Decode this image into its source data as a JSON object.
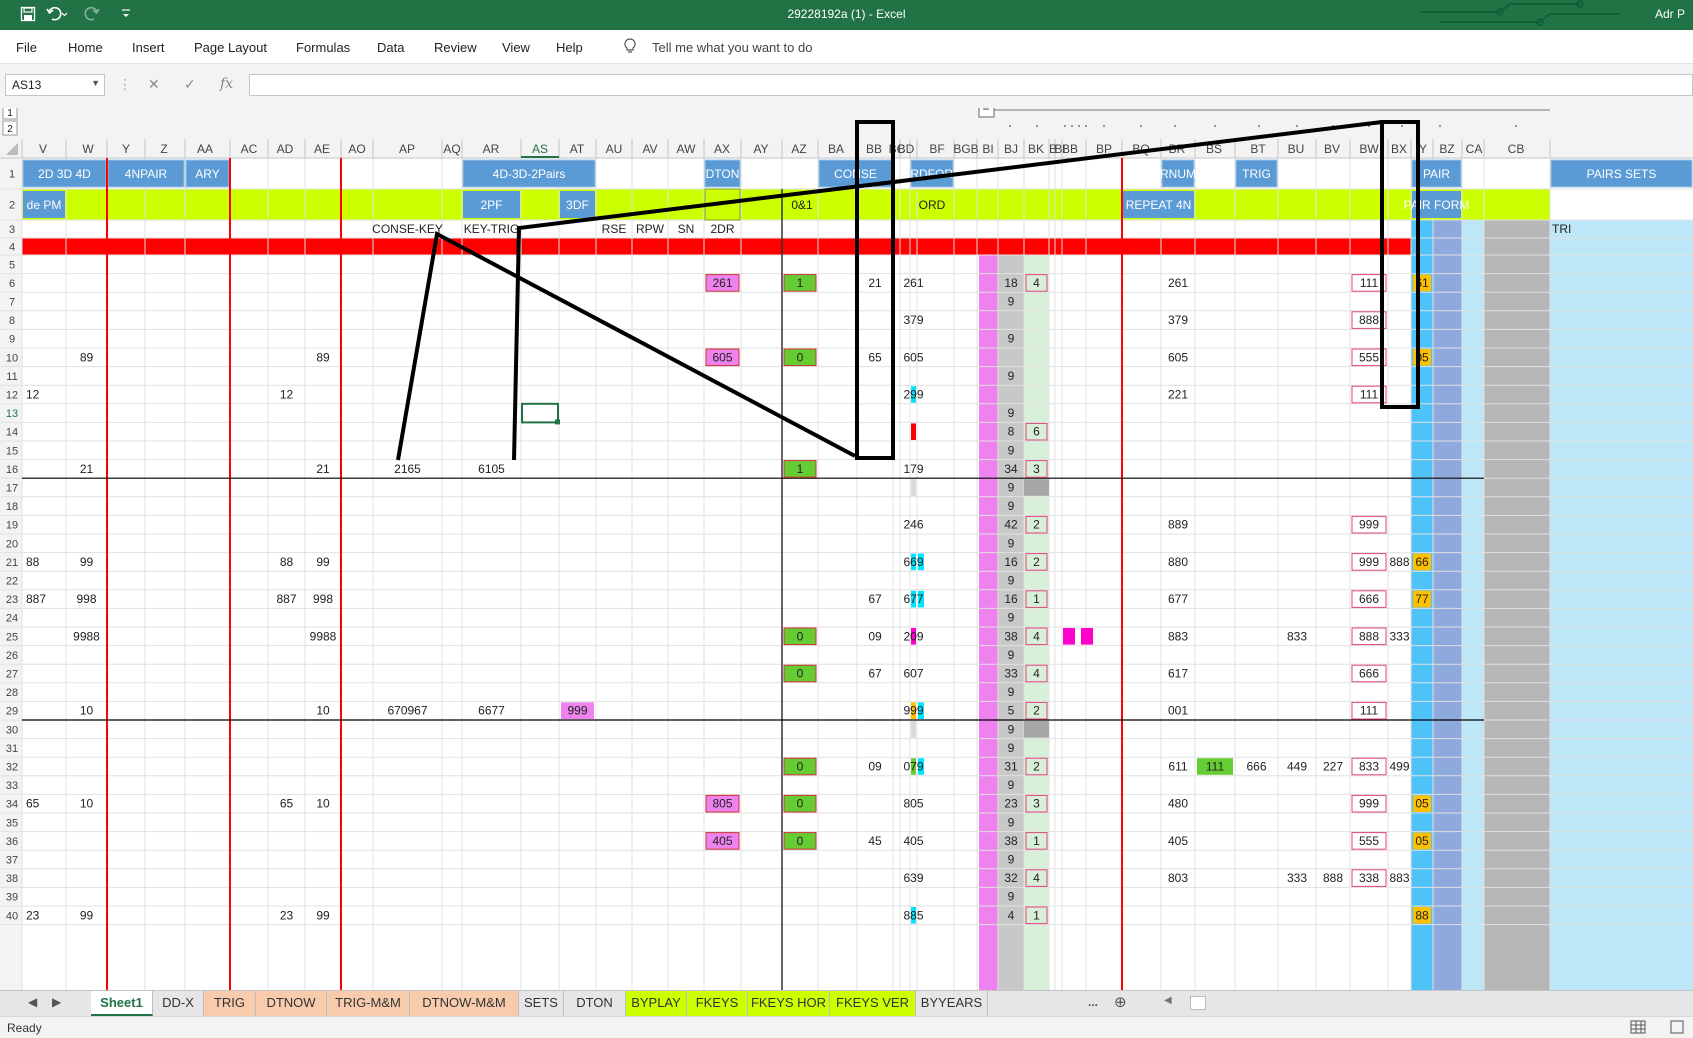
{
  "titlebar": {
    "title": "29228192a (1)  -  Excel",
    "user": "Adr P",
    "icons": [
      "save-icon",
      "undo-icon",
      "redo-icon",
      "customize-icon"
    ]
  },
  "menu": {
    "tabs": [
      "File",
      "Home",
      "Insert",
      "Page Layout",
      "Formulas",
      "Data",
      "Review",
      "View",
      "Help"
    ],
    "tell_me": "Tell me what you want to do"
  },
  "formula_bar": {
    "name_box": "AS13",
    "cancel": "✕",
    "enter": "✓",
    "fx": "fx",
    "value": ""
  },
  "outline": {
    "levels": [
      "1",
      "2"
    ],
    "collapse": "−"
  },
  "columns": [
    "V",
    "W",
    "Y",
    "Z",
    "AA",
    "AC",
    "AD",
    "AE",
    "AO",
    "AP",
    "AQ",
    "AR",
    "AS",
    "AT",
    "AU",
    "AV",
    "AW",
    "AX",
    "AY",
    "AZ",
    "BA",
    "BB",
    "BC",
    "BD",
    "BF",
    "BG",
    "BH",
    "BI",
    "BJ",
    "BK",
    "BL",
    "BM",
    "BN",
    "BO",
    "BP",
    "BQ",
    "BR",
    "BS",
    "BT",
    "BU",
    "BV",
    "BW",
    "BX",
    "BY",
    "BZ",
    "CA",
    "CB"
  ],
  "column_header_labels": [
    "V",
    "W",
    "Y",
    "Z",
    "AA",
    "AC",
    "AD",
    "AE",
    "AO",
    "AP",
    "AQ",
    "AR",
    "AS",
    "AT",
    "AU",
    "AV",
    "AW",
    "AX",
    "AY",
    "AZ",
    "BA",
    "BB",
    "BC",
    "BD",
    "BF",
    "BGB",
    "BI",
    "BJ",
    "BK",
    "B",
    "BI",
    "BB",
    "BP",
    "BQ",
    "BR",
    "BS",
    "BT",
    "BU",
    "BV",
    "BW",
    "BX",
    "Y",
    "BZ",
    "CA",
    "CB"
  ],
  "rows": [
    "1",
    "2",
    "3",
    "4",
    "5",
    "6",
    "7",
    "8",
    "9",
    "10",
    "11",
    "12",
    "13",
    "14",
    "15",
    "16",
    "17",
    "18",
    "19",
    "20",
    "21",
    "22",
    "23",
    "24",
    "25",
    "26",
    "27",
    "28",
    "29",
    "30",
    "31",
    "32",
    "33",
    "34",
    "35",
    "36",
    "37",
    "38",
    "39",
    "40"
  ],
  "headers_row1": [
    {
      "text": "2D 3D 4D"
    },
    {
      "text": "4NPAIR"
    },
    {
      "text": "ARY"
    },
    {
      "text": "4D-3D-2Pairs"
    },
    {
      "text": "DTON"
    },
    {
      "text": "CONSE"
    },
    {
      "text": "ORDFORM"
    },
    {
      "text": "RNUM"
    },
    {
      "text": "TRIG"
    },
    {
      "text": "PAIR"
    },
    {
      "text": "PAIRS SETS"
    }
  ],
  "headers_row2": [
    {
      "text": "de PM"
    },
    {
      "text": "2PF"
    },
    {
      "text": "3DF"
    },
    {
      "text": "0&1"
    },
    {
      "text": "ORD"
    },
    {
      "text": "REPEAT 4N"
    },
    {
      "text": "PAIR FORM"
    }
  ],
  "headers_row3": [
    "CONSE-KEY",
    "KEY-TRIG",
    "RSE",
    "RPW",
    "SN",
    "2DR",
    "TRI"
  ],
  "cells": [
    {
      "r": 6,
      "c": "AX",
      "v": "261"
    },
    {
      "r": 6,
      "c": "AZ",
      "v": "1"
    },
    {
      "r": 6,
      "c": "BB",
      "v": "21"
    },
    {
      "r": 6,
      "c": "BF",
      "v": "261"
    },
    {
      "r": 6,
      "c": "BJ",
      "v": "18"
    },
    {
      "r": 6,
      "c": "BK",
      "v": "4"
    },
    {
      "r": 6,
      "c": "BQ",
      "v": "261"
    },
    {
      "r": 6,
      "c": "BV",
      "v": "111"
    },
    {
      "r": 6,
      "c": "BX",
      "v": "61"
    },
    {
      "r": 7,
      "c": "BJ",
      "v": "9"
    },
    {
      "r": 8,
      "c": "BF",
      "v": "379"
    },
    {
      "r": 8,
      "c": "BQ",
      "v": "379"
    },
    {
      "r": 8,
      "c": "BV",
      "v": "888"
    },
    {
      "r": 9,
      "c": "BJ",
      "v": "9"
    },
    {
      "r": 10,
      "c": "W",
      "v": "89"
    },
    {
      "r": 10,
      "c": "AE",
      "v": "89"
    },
    {
      "r": 10,
      "c": "AX",
      "v": "605"
    },
    {
      "r": 10,
      "c": "AZ",
      "v": "0"
    },
    {
      "r": 10,
      "c": "BB",
      "v": "65"
    },
    {
      "r": 10,
      "c": "BF",
      "v": "605"
    },
    {
      "r": 10,
      "c": "BQ",
      "v": "605"
    },
    {
      "r": 10,
      "c": "BV",
      "v": "555"
    },
    {
      "r": 10,
      "c": "BX",
      "v": "05"
    },
    {
      "r": 11,
      "c": "BJ",
      "v": "9"
    },
    {
      "r": 12,
      "c": "V",
      "v": "12"
    },
    {
      "r": 12,
      "c": "AD",
      "v": "12"
    },
    {
      "r": 12,
      "c": "BF",
      "v": "299"
    },
    {
      "r": 12,
      "c": "BQ",
      "v": "221"
    },
    {
      "r": 12,
      "c": "BV",
      "v": "111"
    },
    {
      "r": 13,
      "c": "BJ",
      "v": "9"
    },
    {
      "r": 14,
      "c": "BJ",
      "v": "8"
    },
    {
      "r": 14,
      "c": "BK",
      "v": "6"
    },
    {
      "r": 15,
      "c": "BJ",
      "v": "9"
    },
    {
      "r": 16,
      "c": "W",
      "v": "21"
    },
    {
      "r": 16,
      "c": "AE",
      "v": "21"
    },
    {
      "r": 16,
      "c": "AP",
      "v": "2165"
    },
    {
      "r": 16,
      "c": "AR",
      "v": "6105"
    },
    {
      "r": 16,
      "c": "AZ",
      "v": "1"
    },
    {
      "r": 16,
      "c": "BF",
      "v": "179"
    },
    {
      "r": 16,
      "c": "BJ",
      "v": "34"
    },
    {
      "r": 16,
      "c": "BK",
      "v": "3"
    },
    {
      "r": 17,
      "c": "BJ",
      "v": "9"
    },
    {
      "r": 18,
      "c": "BJ",
      "v": "9"
    },
    {
      "r": 19,
      "c": "BF",
      "v": "246"
    },
    {
      "r": 19,
      "c": "BJ",
      "v": "42"
    },
    {
      "r": 19,
      "c": "BK",
      "v": "2"
    },
    {
      "r": 19,
      "c": "BQ",
      "v": "889"
    },
    {
      "r": 19,
      "c": "BV",
      "v": "999"
    },
    {
      "r": 20,
      "c": "BJ",
      "v": "9"
    },
    {
      "r": 21,
      "c": "V",
      "v": "88"
    },
    {
      "r": 21,
      "c": "W",
      "v": "99"
    },
    {
      "r": 21,
      "c": "AD",
      "v": "88"
    },
    {
      "r": 21,
      "c": "AE",
      "v": "99"
    },
    {
      "r": 21,
      "c": "BF",
      "v": "669"
    },
    {
      "r": 21,
      "c": "BJ",
      "v": "16"
    },
    {
      "r": 21,
      "c": "BK",
      "v": "2"
    },
    {
      "r": 21,
      "c": "BQ",
      "v": "880"
    },
    {
      "r": 21,
      "c": "BV",
      "v": "999"
    },
    {
      "r": 21,
      "c": "BW",
      "v": "888"
    },
    {
      "r": 21,
      "c": "BX",
      "v": "66"
    },
    {
      "r": 22,
      "c": "BJ",
      "v": "9"
    },
    {
      "r": 23,
      "c": "V",
      "v": "887"
    },
    {
      "r": 23,
      "c": "W",
      "v": "998"
    },
    {
      "r": 23,
      "c": "AD",
      "v": "887"
    },
    {
      "r": 23,
      "c": "AE",
      "v": "998"
    },
    {
      "r": 23,
      "c": "BB",
      "v": "67"
    },
    {
      "r": 23,
      "c": "BF",
      "v": "677"
    },
    {
      "r": 23,
      "c": "BJ",
      "v": "16"
    },
    {
      "r": 23,
      "c": "BK",
      "v": "1"
    },
    {
      "r": 23,
      "c": "BQ",
      "v": "677"
    },
    {
      "r": 23,
      "c": "BV",
      "v": "666"
    },
    {
      "r": 23,
      "c": "BX",
      "v": "77"
    },
    {
      "r": 24,
      "c": "BJ",
      "v": "9"
    },
    {
      "r": 25,
      "c": "W",
      "v": "9988"
    },
    {
      "r": 25,
      "c": "AE",
      "v": "9988"
    },
    {
      "r": 25,
      "c": "AZ",
      "v": "0"
    },
    {
      "r": 25,
      "c": "BB",
      "v": "09"
    },
    {
      "r": 25,
      "c": "BF",
      "v": "209"
    },
    {
      "r": 25,
      "c": "BJ",
      "v": "38"
    },
    {
      "r": 25,
      "c": "BK",
      "v": "4"
    },
    {
      "r": 25,
      "c": "BQ",
      "v": "883"
    },
    {
      "r": 25,
      "c": "BT",
      "v": "833"
    },
    {
      "r": 25,
      "c": "BV",
      "v": "888"
    },
    {
      "r": 25,
      "c": "BW",
      "v": "333"
    },
    {
      "r": 26,
      "c": "BJ",
      "v": "9"
    },
    {
      "r": 27,
      "c": "AZ",
      "v": "0"
    },
    {
      "r": 27,
      "c": "BB",
      "v": "67"
    },
    {
      "r": 27,
      "c": "BF",
      "v": "607"
    },
    {
      "r": 27,
      "c": "BJ",
      "v": "33"
    },
    {
      "r": 27,
      "c": "BK",
      "v": "4"
    },
    {
      "r": 27,
      "c": "BQ",
      "v": "617"
    },
    {
      "r": 27,
      "c": "BV",
      "v": "666"
    },
    {
      "r": 28,
      "c": "BJ",
      "v": "9"
    },
    {
      "r": 29,
      "c": "W",
      "v": "10"
    },
    {
      "r": 29,
      "c": "AE",
      "v": "10"
    },
    {
      "r": 29,
      "c": "AP",
      "v": "670967"
    },
    {
      "r": 29,
      "c": "AR",
      "v": "6677"
    },
    {
      "r": 29,
      "c": "AT",
      "v": "999"
    },
    {
      "r": 29,
      "c": "BF",
      "v": "999"
    },
    {
      "r": 29,
      "c": "BJ",
      "v": "5"
    },
    {
      "r": 29,
      "c": "BK",
      "v": "2"
    },
    {
      "r": 29,
      "c": "BQ",
      "v": "001"
    },
    {
      "r": 29,
      "c": "BV",
      "v": "111"
    },
    {
      "r": 30,
      "c": "BJ",
      "v": "9"
    },
    {
      "r": 31,
      "c": "BJ",
      "v": "9"
    },
    {
      "r": 32,
      "c": "AZ",
      "v": "0"
    },
    {
      "r": 32,
      "c": "BB",
      "v": "09"
    },
    {
      "r": 32,
      "c": "BF",
      "v": "079"
    },
    {
      "r": 32,
      "c": "BJ",
      "v": "31"
    },
    {
      "r": 32,
      "c": "BK",
      "v": "2"
    },
    {
      "r": 32,
      "c": "BQ",
      "v": "611"
    },
    {
      "r": 32,
      "c": "BR",
      "v": "111"
    },
    {
      "r": 32,
      "c": "BS",
      "v": "666"
    },
    {
      "r": 32,
      "c": "BT",
      "v": "449"
    },
    {
      "r": 32,
      "c": "BU",
      "v": "227"
    },
    {
      "r": 32,
      "c": "BV",
      "v": "833"
    },
    {
      "r": 32,
      "c": "BW",
      "v": "499"
    },
    {
      "r": 33,
      "c": "BJ",
      "v": "9"
    },
    {
      "r": 34,
      "c": "V",
      "v": "65"
    },
    {
      "r": 34,
      "c": "W",
      "v": "10"
    },
    {
      "r": 34,
      "c": "AD",
      "v": "65"
    },
    {
      "r": 34,
      "c": "AE",
      "v": "10"
    },
    {
      "r": 34,
      "c": "AX",
      "v": "805"
    },
    {
      "r": 34,
      "c": "AZ",
      "v": "0"
    },
    {
      "r": 34,
      "c": "BF",
      "v": "805"
    },
    {
      "r": 34,
      "c": "BJ",
      "v": "23"
    },
    {
      "r": 34,
      "c": "BK",
      "v": "3"
    },
    {
      "r": 34,
      "c": "BQ",
      "v": "480"
    },
    {
      "r": 34,
      "c": "BV",
      "v": "999"
    },
    {
      "r": 34,
      "c": "BX",
      "v": "05"
    },
    {
      "r": 35,
      "c": "BJ",
      "v": "9"
    },
    {
      "r": 36,
      "c": "AX",
      "v": "405"
    },
    {
      "r": 36,
      "c": "AZ",
      "v": "0"
    },
    {
      "r": 36,
      "c": "BB",
      "v": "45"
    },
    {
      "r": 36,
      "c": "BF",
      "v": "405"
    },
    {
      "r": 36,
      "c": "BJ",
      "v": "38"
    },
    {
      "r": 36,
      "c": "BK",
      "v": "1"
    },
    {
      "r": 36,
      "c": "BQ",
      "v": "405"
    },
    {
      "r": 36,
      "c": "BV",
      "v": "555"
    },
    {
      "r": 36,
      "c": "BX",
      "v": "05"
    },
    {
      "r": 37,
      "c": "BJ",
      "v": "9"
    },
    {
      "r": 38,
      "c": "BF",
      "v": "639"
    },
    {
      "r": 38,
      "c": "BJ",
      "v": "32"
    },
    {
      "r": 38,
      "c": "BK",
      "v": "4"
    },
    {
      "r": 38,
      "c": "BQ",
      "v": "803"
    },
    {
      "r": 38,
      "c": "BT",
      "v": "333"
    },
    {
      "r": 38,
      "c": "BU",
      "v": "888"
    },
    {
      "r": 38,
      "c": "BV",
      "v": "338"
    },
    {
      "r": 38,
      "c": "BW",
      "v": "883"
    },
    {
      "r": 39,
      "c": "BJ",
      "v": "9"
    },
    {
      "r": 40,
      "c": "V",
      "v": "23"
    },
    {
      "r": 40,
      "c": "W",
      "v": "99"
    },
    {
      "r": 40,
      "c": "AD",
      "v": "23"
    },
    {
      "r": 40,
      "c": "AE",
      "v": "99"
    },
    {
      "r": 40,
      "c": "BF",
      "v": "885"
    },
    {
      "r": 40,
      "c": "BJ",
      "v": "4"
    },
    {
      "r": 40,
      "c": "BK",
      "v": "1"
    },
    {
      "r": 40,
      "c": "BX",
      "v": "88"
    }
  ],
  "sheet_tabs": [
    {
      "label": "Sheet1",
      "style": "active"
    },
    {
      "label": "DD-X",
      "style": "plain"
    },
    {
      "label": "TRIG",
      "style": "orange"
    },
    {
      "label": "DTNOW",
      "style": "orange"
    },
    {
      "label": "TRIG-M&M",
      "style": "orange"
    },
    {
      "label": "DTNOW-M&M",
      "style": "orange"
    },
    {
      "label": "SETS",
      "style": "plain"
    },
    {
      "label": "DTON",
      "style": "plain"
    },
    {
      "label": "BYPLAY",
      "style": "lime"
    },
    {
      "label": "FKEYS",
      "style": "lime"
    },
    {
      "label": "FKEYS HOR",
      "style": "lime"
    },
    {
      "label": "FKEYS VER",
      "style": "lime"
    },
    {
      "label": "BYYEARS",
      "style": "plain"
    }
  ],
  "sheet_nav": {
    "more": "...",
    "add": "⊕"
  },
  "status": {
    "ready": "Ready"
  },
  "colors": {
    "title_green": "#217346",
    "header_blue": "#5b9bd5",
    "lime": "#ccff00",
    "red_band": "#ff0000",
    "magenta": "#ee82ee",
    "green_cell": "#66cc33",
    "cyan": "#00e5ff",
    "gold": "#ffc000",
    "sky": "#4fc3f7"
  }
}
